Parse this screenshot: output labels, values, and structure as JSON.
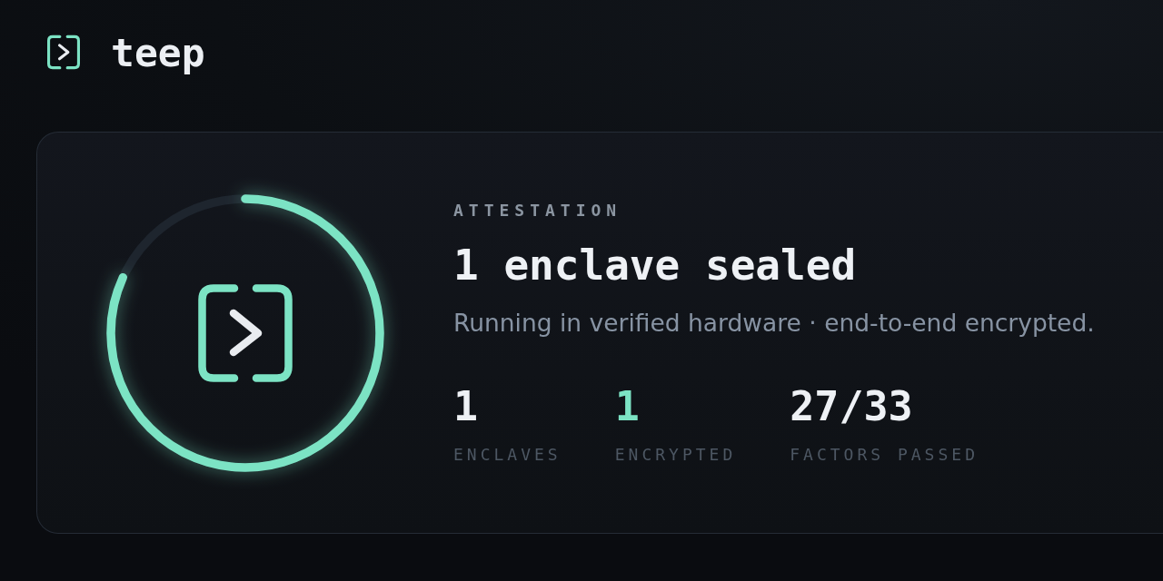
{
  "header": {
    "brand": "teep"
  },
  "attestation": {
    "label": "ATTESTATION",
    "title": "1 enclave sealed",
    "description": "Running in verified hardware · end-to-end encrypted.",
    "ring": {
      "level": 0.818
    },
    "stats": [
      {
        "value": "1",
        "label": "ENCLAVES",
        "color": "#eef1f5"
      },
      {
        "value": "1",
        "label": "ENCRYPTED",
        "color": "#7ce3c4"
      },
      {
        "value": "27/33",
        "label": "FACTORS PASSED",
        "color": "#eef1f5"
      }
    ]
  }
}
